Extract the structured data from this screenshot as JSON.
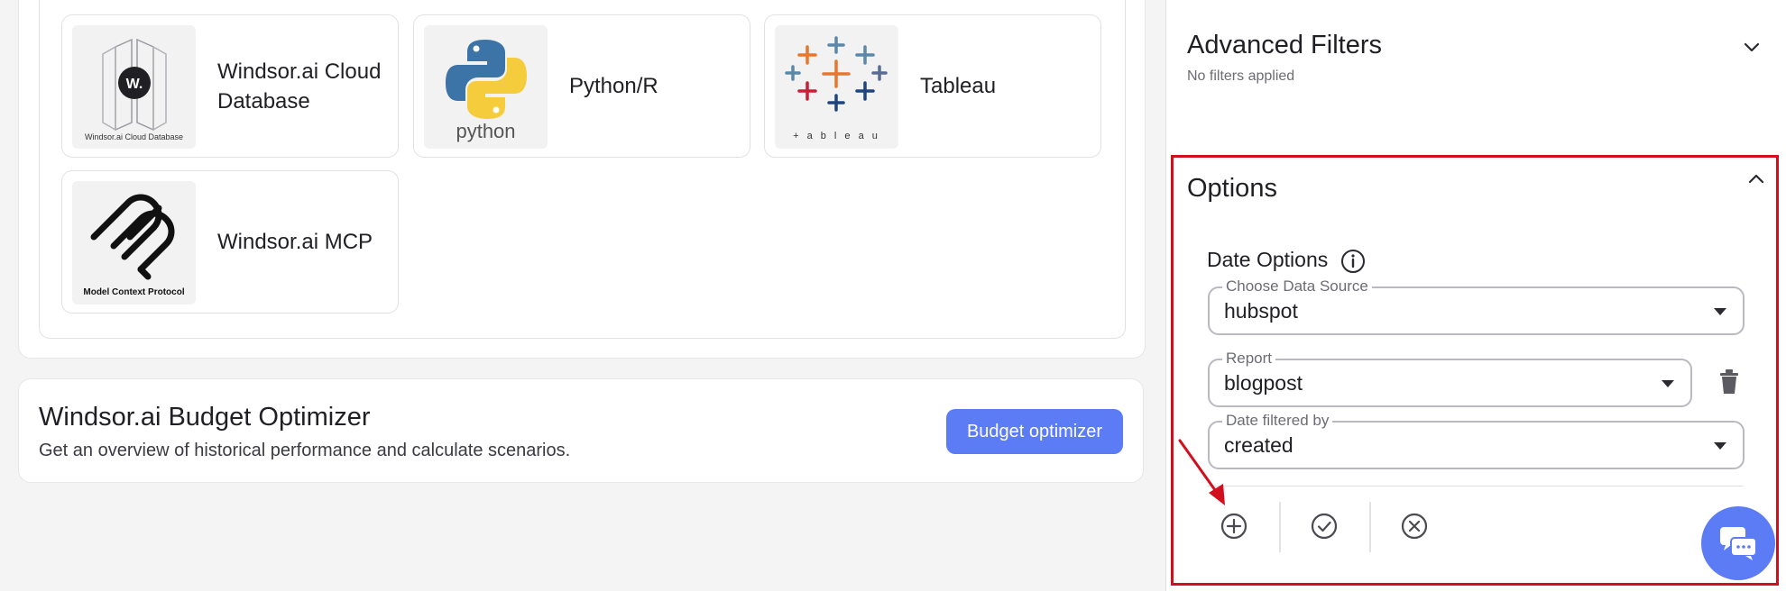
{
  "destinations": {
    "tiles": [
      {
        "name": "Windsor.ai Cloud Database",
        "logo_caption": "Windsor.ai Cloud Database",
        "icon": "windsor-cloud-database-logo"
      },
      {
        "name": "Python/R",
        "logo_caption": "python",
        "icon": "python-logo"
      },
      {
        "name": "Tableau",
        "logo_caption": "+ a b l e a u",
        "icon": "tableau-logo"
      },
      {
        "name": "Windsor.ai MCP",
        "logo_caption": "Model Context Protocol",
        "icon": "mcp-logo"
      }
    ]
  },
  "budget": {
    "title": "Windsor.ai Budget Optimizer",
    "subtitle": "Get an overview of historical performance and calculate scenarios.",
    "button_label": "Budget optimizer"
  },
  "advanced_filters": {
    "title": "Advanced Filters",
    "subtitle": "No filters applied"
  },
  "options": {
    "title": "Options",
    "date_options_label": "Date Options",
    "data_source": {
      "legend": "Choose Data Source",
      "value": "hubspot"
    },
    "report": {
      "legend": "Report",
      "value": "blogpost"
    },
    "date_filtered_by": {
      "legend": "Date filtered by",
      "value": "created"
    }
  },
  "colors": {
    "accent": "#5b7cf5",
    "highlight_border": "#d10f1f"
  }
}
